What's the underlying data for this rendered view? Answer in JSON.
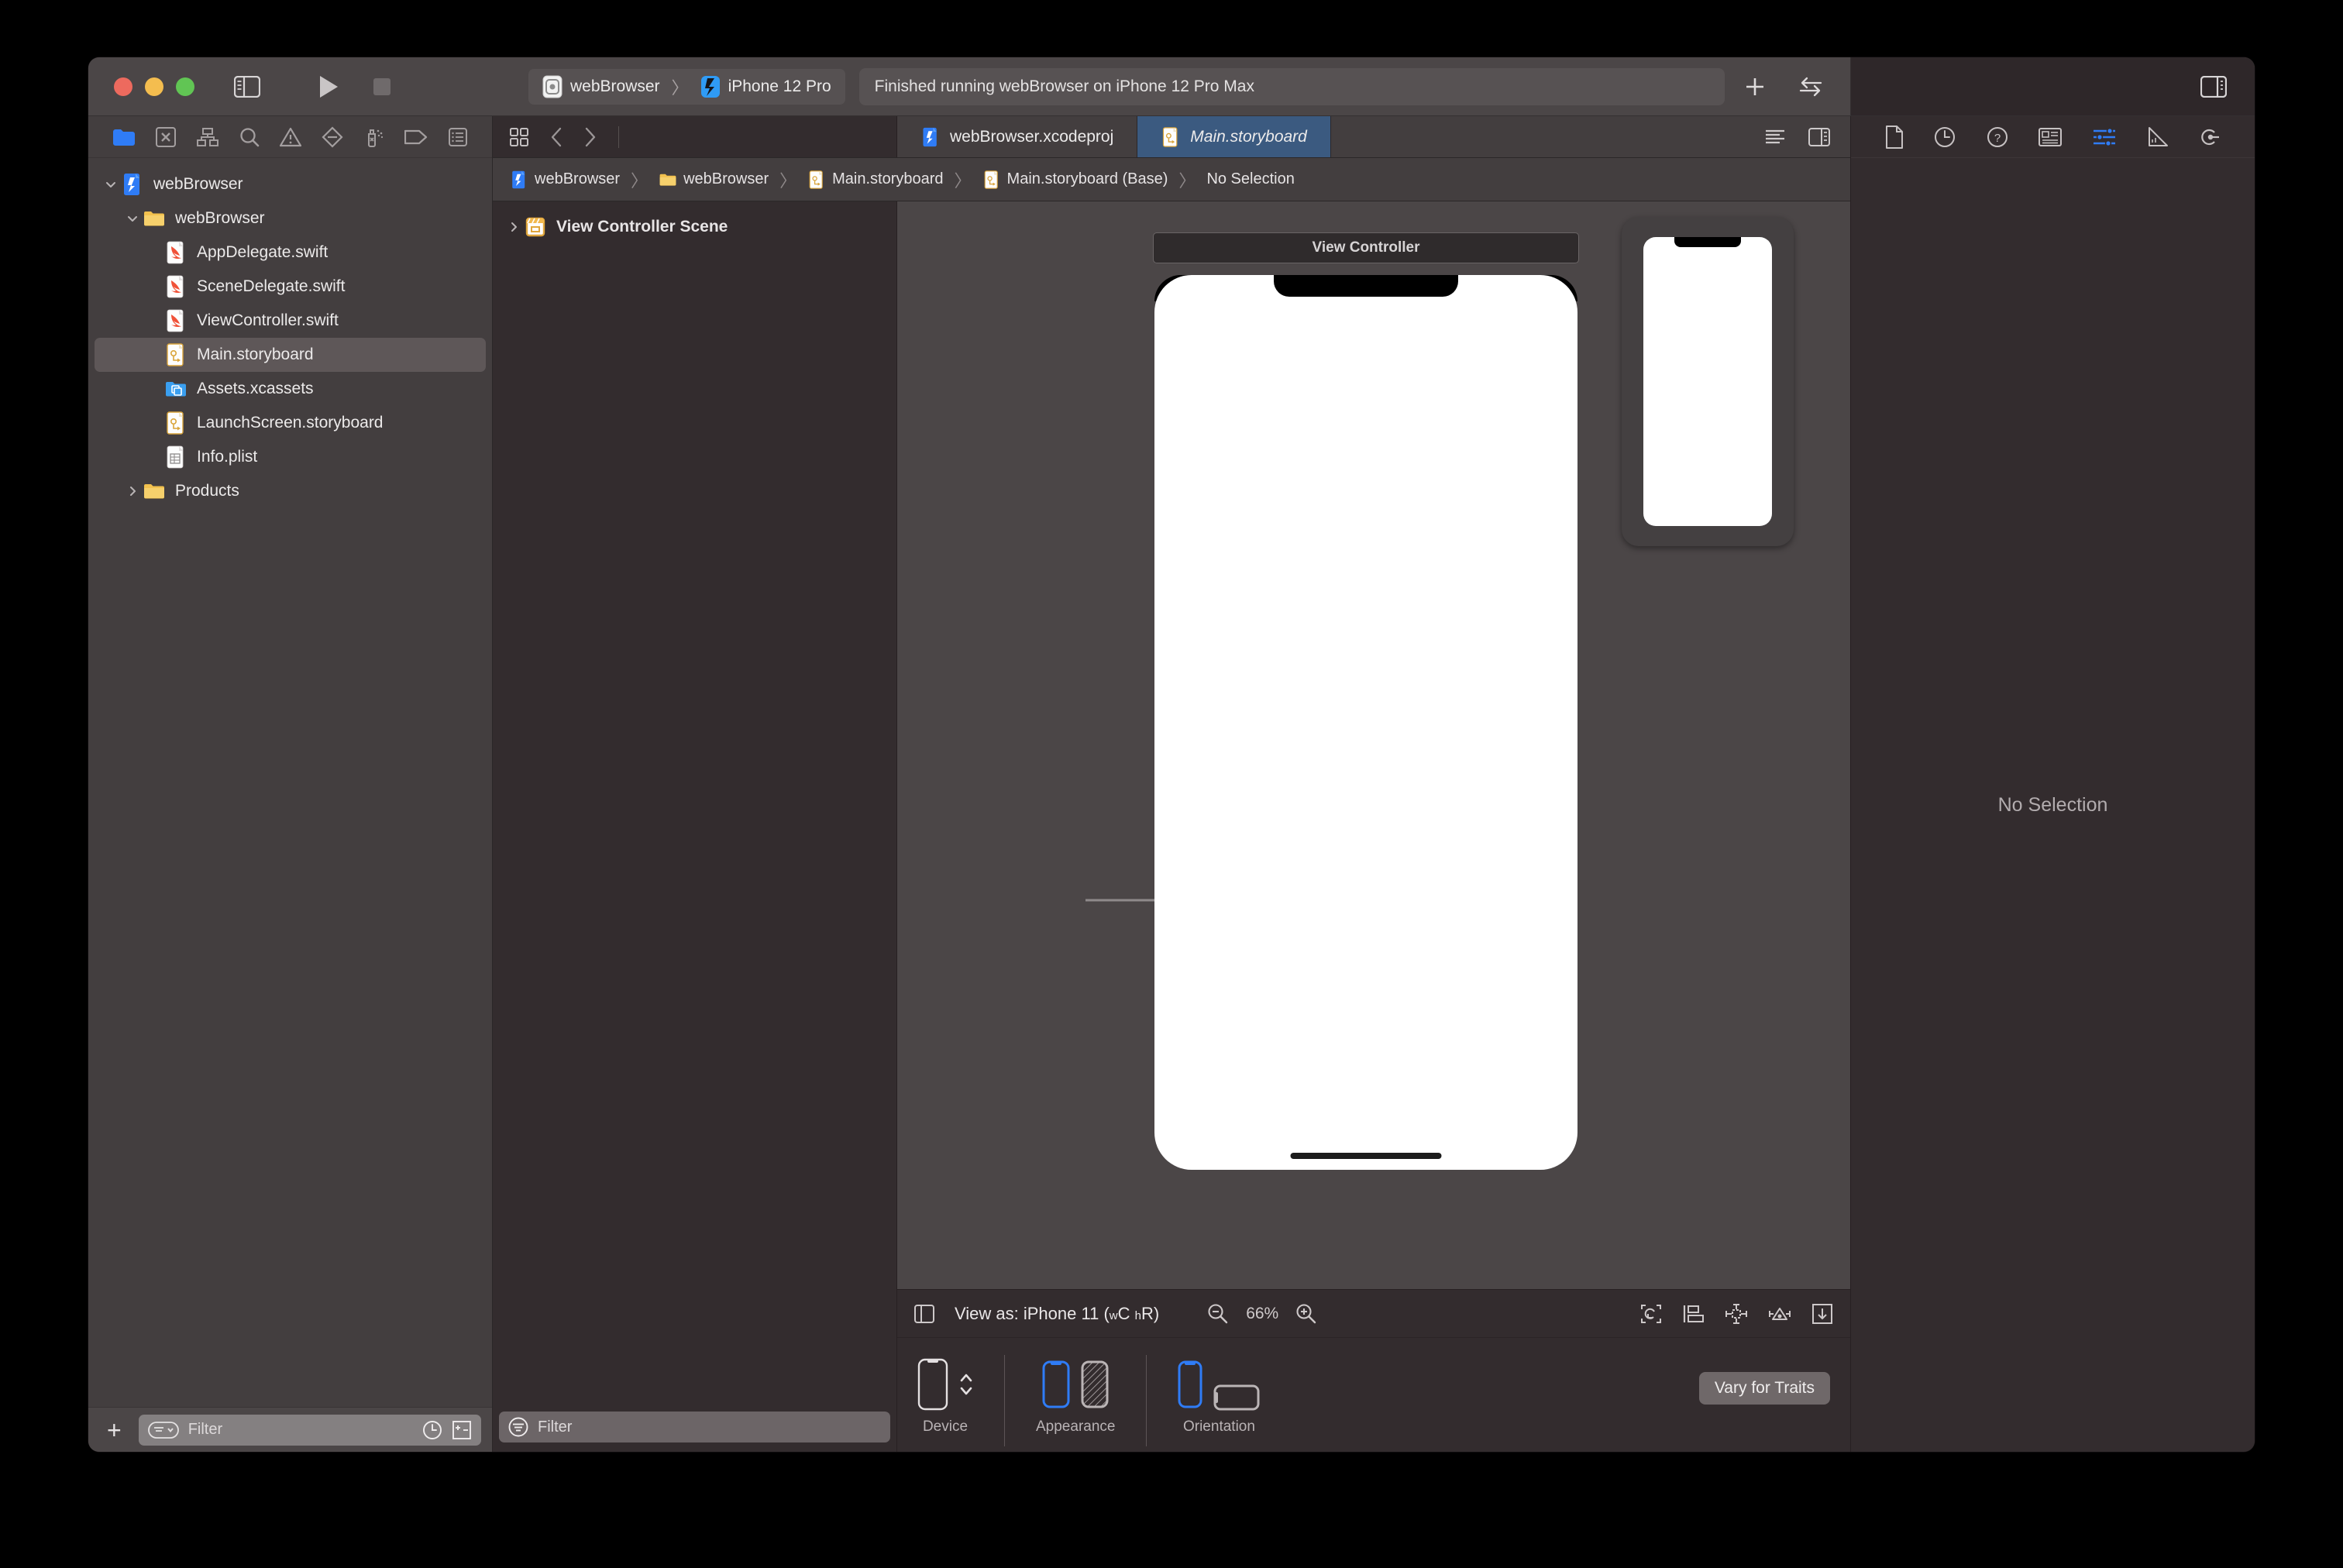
{
  "window": {
    "traffic_lights": [
      "close",
      "minimize",
      "zoom"
    ],
    "colors": {
      "close": "#ed6a5e",
      "minimize": "#f4bd4f",
      "zoom": "#61c554",
      "accent": "#0a84ff",
      "tab_active": "#3b5a80"
    }
  },
  "toolbar": {
    "sidebar_toggle_icon": "sidebar-toggle-icon",
    "run_icon": "run-play-icon",
    "stop_icon": "stop-square-icon",
    "scheme": {
      "project": "webBrowser",
      "separator": "〉",
      "destination": "iPhone 12 Pro"
    },
    "status": "Finished running webBrowser on iPhone 12 Pro Max",
    "add_icon": "plus-icon",
    "code_review_icon": "code-review-arrows-icon",
    "inspector_toggle_icon": "inspector-toggle-icon"
  },
  "navigator": {
    "tabs": [
      {
        "name": "project-navigator",
        "icon": "folder-icon",
        "active": true
      },
      {
        "name": "source-control-navigator",
        "icon": "source-control-icon",
        "active": false
      },
      {
        "name": "symbol-navigator",
        "icon": "hierarchy-icon",
        "active": false
      },
      {
        "name": "find-navigator",
        "icon": "search-icon",
        "active": false
      },
      {
        "name": "issue-navigator",
        "icon": "warning-triangle-icon",
        "active": false
      },
      {
        "name": "test-navigator",
        "icon": "diamond-minus-icon",
        "active": false
      },
      {
        "name": "debug-navigator",
        "icon": "spray-can-icon",
        "active": false
      },
      {
        "name": "breakpoint-navigator",
        "icon": "tag-icon",
        "active": false
      },
      {
        "name": "report-navigator",
        "icon": "report-list-icon",
        "active": false
      }
    ],
    "tree": [
      {
        "label": "webBrowser",
        "icon": "xcodeproj-icon",
        "depth": 0,
        "twisty": "down",
        "selected": false
      },
      {
        "label": "webBrowser",
        "icon": "folder-icon",
        "depth": 1,
        "twisty": "down",
        "selected": false
      },
      {
        "label": "AppDelegate.swift",
        "icon": "swift-icon",
        "depth": 2,
        "twisty": "none",
        "selected": false
      },
      {
        "label": "SceneDelegate.swift",
        "icon": "swift-icon",
        "depth": 2,
        "twisty": "none",
        "selected": false
      },
      {
        "label": "ViewController.swift",
        "icon": "swift-icon",
        "depth": 2,
        "twisty": "none",
        "selected": false
      },
      {
        "label": "Main.storyboard",
        "icon": "storyboard-icon",
        "depth": 2,
        "twisty": "none",
        "selected": true
      },
      {
        "label": "Assets.xcassets",
        "icon": "xcassets-icon",
        "depth": 2,
        "twisty": "none",
        "selected": false
      },
      {
        "label": "LaunchScreen.storyboard",
        "icon": "storyboard-icon",
        "depth": 2,
        "twisty": "none",
        "selected": false
      },
      {
        "label": "Info.plist",
        "icon": "plist-icon",
        "depth": 2,
        "twisty": "none",
        "selected": false
      },
      {
        "label": "Products",
        "icon": "folder-icon",
        "depth": 1,
        "twisty": "right",
        "selected": false
      }
    ],
    "filter": {
      "add_label": "+",
      "placeholder": "Filter",
      "scope_icon": "filter-scope-icon",
      "recent_icon": "clock-icon",
      "sourcecontrol_icon": "plus-minus-icon"
    }
  },
  "editor": {
    "tab_grid_icon": "tab-grid-icon",
    "back_icon": "chevron-left-icon",
    "forward_icon": "chevron-right-icon",
    "tabs": [
      {
        "label": "webBrowser.xcodeproj",
        "icon": "xcodeproj-icon",
        "active": false,
        "italic": false
      },
      {
        "label": "Main.storyboard",
        "icon": "storyboard-icon",
        "active": true,
        "italic": true
      }
    ],
    "right_icons": [
      "editor-options-icon",
      "assistant-editor-icon"
    ],
    "breadcrumb": [
      {
        "label": "webBrowser",
        "icon": "xcodeproj-icon"
      },
      {
        "label": "webBrowser",
        "icon": "folder-icon"
      },
      {
        "label": "Main.storyboard",
        "icon": "storyboard-icon"
      },
      {
        "label": "Main.storyboard (Base)",
        "icon": "storyboard-icon"
      },
      {
        "label": "No Selection",
        "icon": "none"
      }
    ],
    "breadcrumb_separator": "〉"
  },
  "outline": {
    "items": [
      {
        "label": "View Controller Scene",
        "icon": "scene-clapper-icon",
        "twisty": "right"
      }
    ],
    "filter": {
      "placeholder": "Filter",
      "scope_icon": "filter-scope-icon"
    }
  },
  "canvas": {
    "scene_label": "View Controller",
    "view_as": {
      "prefix": "View as:",
      "device": "iPhone 11",
      "traits": "(wC hR)",
      "width_class": "wC",
      "height_class": "hR"
    },
    "zoom": {
      "out_icon": "zoom-out-icon",
      "percent": "66%",
      "in_icon": "zoom-in-icon"
    },
    "outline_toggle_icon": "document-outline-toggle-icon",
    "constraint_icons": [
      "update-frames-icon",
      "embed-in-icon",
      "align-icon",
      "add-constraints-icon",
      "resolve-auto-layout-icon"
    ],
    "traits": {
      "device": {
        "label": "Device",
        "icon": "iphone-portrait-icon",
        "stepper_icon": "stepper-updown-icon"
      },
      "appearance": {
        "label": "Appearance",
        "options": [
          {
            "name": "light-appearance",
            "icon": "iphone-light-icon",
            "selected": true
          },
          {
            "name": "dark-appearance",
            "icon": "iphone-dark-icon",
            "selected": false
          }
        ]
      },
      "orientation": {
        "label": "Orientation",
        "options": [
          {
            "name": "portrait-orientation",
            "icon": "iphone-portrait-icon",
            "selected": true
          },
          {
            "name": "landscape-orientation",
            "icon": "iphone-landscape-icon",
            "selected": false
          }
        ]
      },
      "vary_button": "Vary for Traits"
    }
  },
  "inspector": {
    "tabs": [
      {
        "name": "file-inspector",
        "icon": "document-icon",
        "active": false
      },
      {
        "name": "history-inspector",
        "icon": "clock-icon",
        "active": false
      },
      {
        "name": "quick-help-inspector",
        "icon": "question-circle-icon",
        "active": false
      },
      {
        "name": "identity-inspector",
        "icon": "identity-card-icon",
        "active": false
      },
      {
        "name": "attributes-inspector",
        "icon": "sliders-icon",
        "active": true
      },
      {
        "name": "size-inspector",
        "icon": "ruler-icon",
        "active": false
      },
      {
        "name": "connections-inspector",
        "icon": "connections-icon",
        "active": false
      }
    ],
    "empty_message": "No Selection"
  }
}
